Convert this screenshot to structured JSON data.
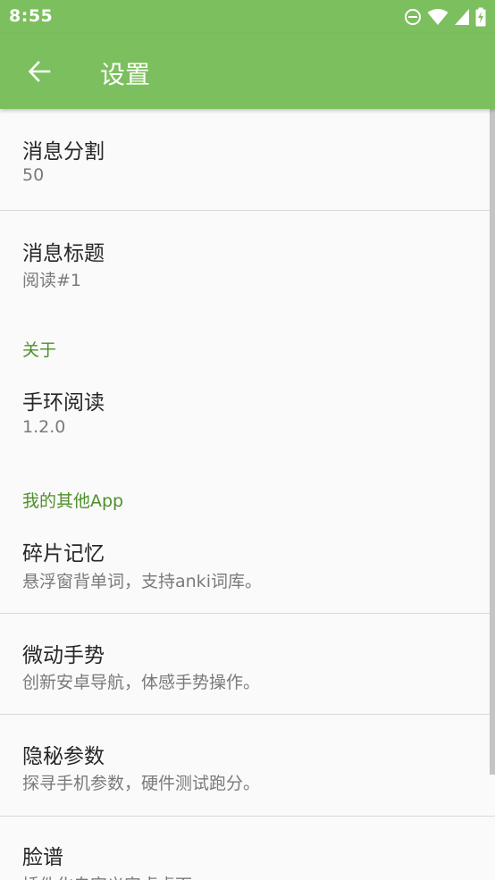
{
  "status": {
    "time": "8:55"
  },
  "toolbar": {
    "title": "设置"
  },
  "prefs": [
    {
      "title": "消息分割",
      "summary": "50"
    },
    {
      "title": "消息标题",
      "summary": "阅读#1"
    }
  ],
  "about": {
    "header": "关于",
    "items": [
      {
        "title": "手环阅读",
        "summary": "1.2.0"
      }
    ]
  },
  "other_apps": {
    "header": "我的其他App",
    "items": [
      {
        "title": "碎片记忆",
        "summary": "悬浮窗背单词，支持anki词库。"
      },
      {
        "title": "微动手势",
        "summary": "创新安卓导航，体感手势操作。"
      },
      {
        "title": "隐秘参数",
        "summary": "探寻手机参数，硬件测试跑分。"
      },
      {
        "title": "脸谱",
        "summary": "插件化自定义安卓桌面"
      }
    ]
  },
  "colors": {
    "primary": "#7cbf5e",
    "accent": "#4f8f2b",
    "background": "#fafafa"
  },
  "icons": [
    "do-not-disturb-icon",
    "wifi-icon",
    "cell-signal-icon",
    "battery-charging-icon",
    "arrow-back-icon"
  ]
}
